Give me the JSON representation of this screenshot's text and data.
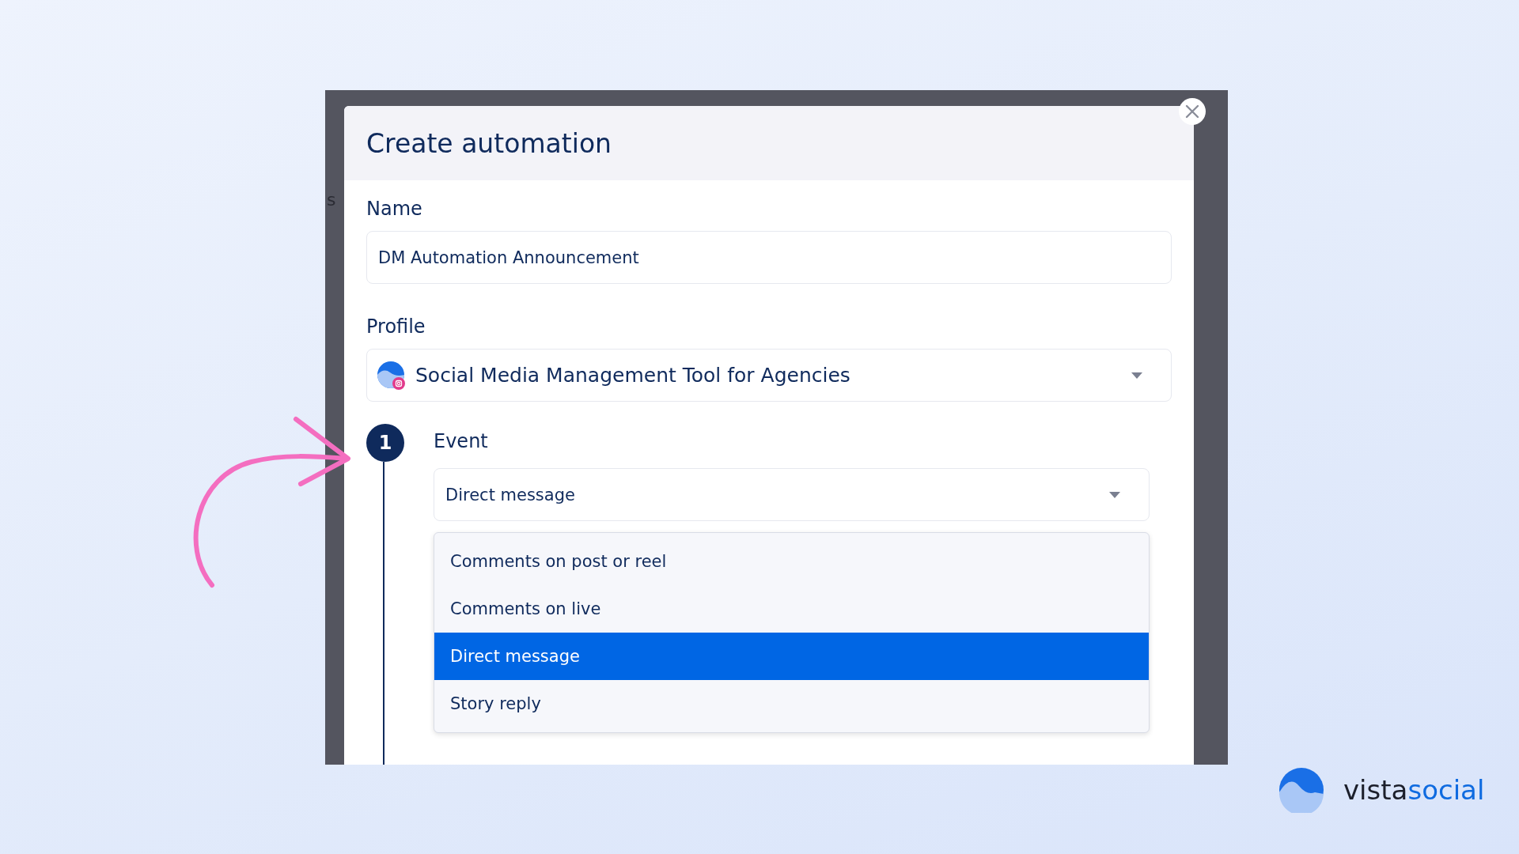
{
  "background_fragment": "s",
  "dialog": {
    "title": "Create automation",
    "name": {
      "label": "Name",
      "value": "DM Automation Announcement"
    },
    "profile": {
      "label": "Profile",
      "value": "Social Media Management Tool for Agencies"
    },
    "step": {
      "number": "1",
      "label": "Event",
      "value": "Direct message",
      "options": [
        {
          "label": "Comments on post or reel",
          "selected": false
        },
        {
          "label": "Comments on live",
          "selected": false
        },
        {
          "label": "Direct message",
          "selected": true
        },
        {
          "label": "Story reply",
          "selected": false
        }
      ]
    }
  },
  "logo": {
    "word_1": "vista",
    "word_2": "social"
  }
}
